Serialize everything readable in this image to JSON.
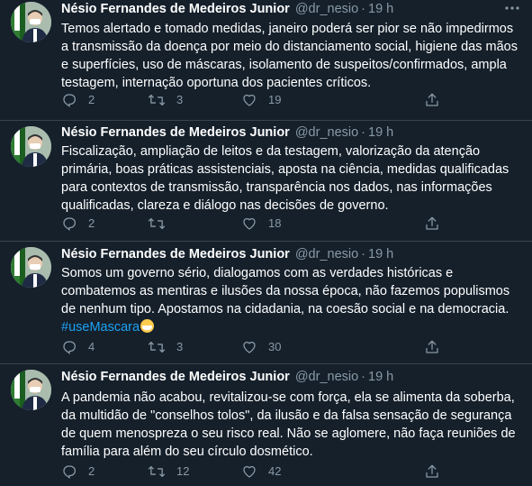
{
  "colors": {
    "background": "#15202b",
    "text": "#ffffff",
    "secondary": "#8899a6",
    "link": "#1da1f2",
    "divider": "#38444d"
  },
  "tweets": [
    {
      "name": "Nésio Fernandes de Medeiros Junior",
      "handle": "@dr_nesio",
      "separator": "·",
      "time": "19 h",
      "text": "Temos alertado e tomado medidas, janeiro poderá ser pior se não impedirmos a transmissão da doença por meio do distanciamento social, higiene das mãos e superfícies, uso de máscaras, isolamento de suspeitos/confirmados, ampla testagem, internação oportuna dos pacientes críticos.",
      "hashtag": "",
      "replies": "2",
      "retweets": "3",
      "likes": "19"
    },
    {
      "name": "Nésio Fernandes de Medeiros Junior",
      "handle": "@dr_nesio",
      "separator": "·",
      "time": "19 h",
      "text": "Fiscalização, ampliação de leitos e da testagem, valorização da atenção primária, boas práticas assistenciais,  aposta na ciência, medidas qualificadas para contextos de transmissão, transparência nos dados, nas informações qualificadas, clareza e diálogo nas decisões de governo.",
      "hashtag": "",
      "replies": "2",
      "retweets": "",
      "likes": "18"
    },
    {
      "name": "Nésio Fernandes de Medeiros Junior",
      "handle": "@dr_nesio",
      "separator": "·",
      "time": "19 h",
      "text": "Somos um governo sério, dialogamos com as verdades históricas e combatemos as mentiras e ilusões da nossa época, não fazemos populismos de nenhum tipo. Apostamos na cidadania, na coesão social e na democracia.",
      "hashtag": "#useMascara",
      "replies": "4",
      "retweets": "3",
      "likes": "30"
    },
    {
      "name": "Nésio Fernandes de Medeiros Junior",
      "handle": "@dr_nesio",
      "separator": "·",
      "time": "19 h",
      "text": "A pandemia não acabou, revitalizou-se com força, ela se alimenta da soberba, da multidão de \"conselhos tolos\", da ilusão e da falsa sensação de segurança de quem menospreza o seu risco real. Não se aglomere, não faça reuniões de família para além do seu círculo dosmético.",
      "hashtag": "",
      "replies": "2",
      "retweets": "12",
      "likes": "42"
    }
  ],
  "icons": {
    "avatar": "profile-photo",
    "more": "more-options-icon",
    "reply": "reply-icon",
    "retweet": "retweet-icon",
    "like": "heart-icon",
    "share": "share-icon"
  }
}
